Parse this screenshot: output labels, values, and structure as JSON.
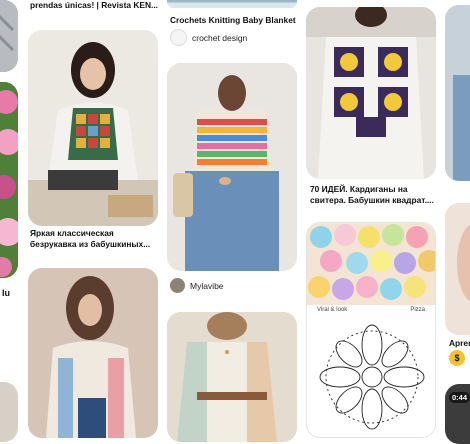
{
  "pins": {
    "col2_top_caption": "prendas únicas! | Revista KEN...",
    "col3_top_caption": "Crochets Knitting Baby Blanket",
    "col3_top_source": "crochet design",
    "col4_caption": "70 ИДЕЙ. Кардиганы на\nсвитера. Бабушкин квадрат....",
    "col2_mid_caption": "Яркая классическая\nбезрукавка из бабушкиных...",
    "col3_mid_source": "Mylavibe",
    "pattern_header": {
      "left": "Viral & look",
      "right": "Pizza"
    },
    "col5_caption": "Apren",
    "col5_badge": "$",
    "col5_time": "0:44",
    "col1_small_text": "Iu"
  }
}
